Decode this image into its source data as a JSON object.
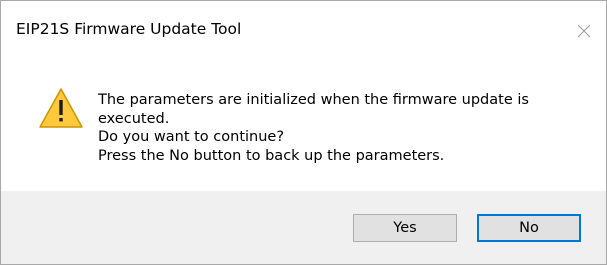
{
  "window": {
    "title": "EIP21S Firmware Update Tool"
  },
  "icons": {
    "close": "close-icon",
    "warning": "warning-icon"
  },
  "message": {
    "line1": "The parameters are initialized when the firmware update is",
    "line2": "executed.",
    "line3": "Do you want to continue?",
    "line4": "Press the No button to back up the parameters."
  },
  "buttons": {
    "yes_label": "Yes",
    "no_label": "No"
  },
  "colors": {
    "warning_fill": "#FFC83D",
    "warning_outline": "#C99700",
    "default_button_border": "#0078D7",
    "footer_bg": "#F0F0F0"
  }
}
